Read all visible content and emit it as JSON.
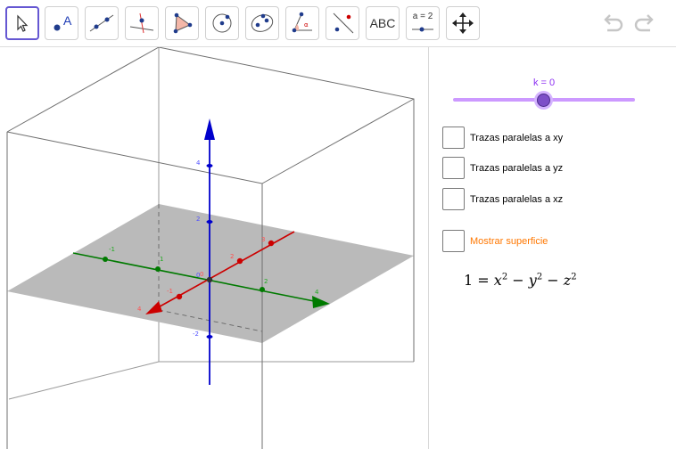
{
  "toolbar": {
    "tools": [
      {
        "name": "move-tool",
        "label": ""
      },
      {
        "name": "point-tool",
        "label": "A"
      },
      {
        "name": "line-tool",
        "label": ""
      },
      {
        "name": "perpendicular-line-tool",
        "label": ""
      },
      {
        "name": "polygon-tool",
        "label": ""
      },
      {
        "name": "circle-center-point-tool",
        "label": ""
      },
      {
        "name": "conic-tool",
        "label": ""
      },
      {
        "name": "angle-tool",
        "label": ""
      },
      {
        "name": "reflect-tool",
        "label": ""
      },
      {
        "name": "text-tool",
        "label": "ABC"
      },
      {
        "name": "slider-tool",
        "label": "a = 2"
      },
      {
        "name": "move-graphics-tool",
        "label": ""
      }
    ],
    "active_tool": "move-tool"
  },
  "graphics": {
    "axis_colors": {
      "x": "#cc0000",
      "y": "#006600",
      "z": "#0000cc"
    },
    "plane_color": "#bababa",
    "x_tick_labels": [
      "-1",
      "0",
      "1",
      "2",
      "3",
      "4"
    ],
    "y_tick_labels": [
      "1",
      "2",
      "3",
      "4",
      "-1",
      "-2"
    ],
    "z_tick_labels": [
      "4",
      "2",
      "0",
      "-2"
    ],
    "origin_label": "0"
  },
  "algebra": {
    "slider": {
      "label": "k = 0",
      "value": 0,
      "min": -1,
      "max": 1,
      "color": "#8c2ff2"
    },
    "checkboxes": [
      {
        "label": "Trazas paralelas a xy",
        "checked": false
      },
      {
        "label": "Trazas paralelas a yz",
        "checked": false
      },
      {
        "label": "Trazas paralelas a xz",
        "checked": false
      },
      {
        "label": "Mostrar superficie",
        "checked": false,
        "color": "#ff7700"
      }
    ],
    "formula": {
      "lhs": "1",
      "eq": "=",
      "t1": "x",
      "t2": "y",
      "t3": "z",
      "exp": "2"
    }
  }
}
